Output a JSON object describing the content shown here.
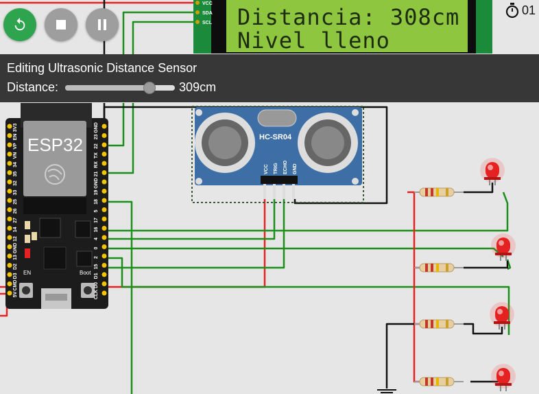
{
  "toolbar": {
    "restart_icon": "restart-icon",
    "stop_icon": "stop-icon",
    "pause_icon": "pause-icon",
    "restart_color": "#2ea44f",
    "stop_color": "#9e9e9e",
    "pause_color": "#9e9e9e"
  },
  "timer": {
    "icon": "stopwatch-icon",
    "value": "01"
  },
  "lcd": {
    "line1": "Distancia: 308cm",
    "line2": "Nivel lleno",
    "pins": [
      "VCC",
      "SDA",
      "SCL"
    ],
    "backlight_color": "#8ec63f"
  },
  "edit_panel": {
    "title": "Editing Ultrasonic Distance Sensor",
    "distance_label": "Distance:",
    "distance_value": "309cm",
    "slider_fraction": 0.77
  },
  "esp32": {
    "label": "ESP32",
    "en_label": "EN",
    "boot_label": "Boot",
    "left_pins": [
      "3V3",
      "EN",
      "VP",
      "VN",
      "34",
      "35",
      "32",
      "33",
      "25",
      "26",
      "27",
      "14",
      "12",
      "GND",
      "13",
      "D2",
      "D3",
      "CMD",
      "5V"
    ],
    "right_pins": [
      "GND",
      "23",
      "22",
      "TX",
      "RX",
      "21",
      "GND",
      "19",
      "18",
      "5",
      "17",
      "16",
      "4",
      "0",
      "2",
      "15",
      "D1",
      "D0",
      "CLK"
    ]
  },
  "sensor": {
    "label": "HC-SR04",
    "pins": [
      "VCC",
      "TRIG",
      "ECHO",
      "GND"
    ]
  },
  "leds": {
    "count": 4,
    "color": "#e52222"
  },
  "wire_colors": {
    "power": "#e52222",
    "signal": "#1a8f1a",
    "ground": "#111111"
  }
}
